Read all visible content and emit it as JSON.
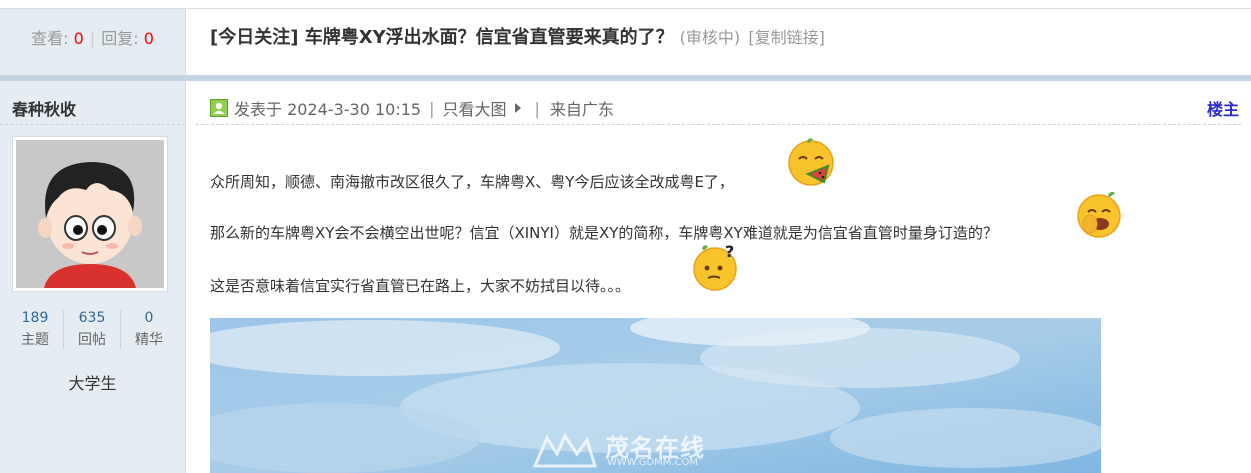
{
  "thread": {
    "views_label": "查看:",
    "views": "0",
    "replies_label": "回复:",
    "replies": "0",
    "title": "[今日关注] 车牌粤XY浮出水面？信宜省直管要来真的了？",
    "status": "(审核中)",
    "copy_link": "[复制链接]"
  },
  "author": {
    "name": "春种秋收",
    "stats": [
      {
        "value": "189",
        "label": "主题"
      },
      {
        "value": "635",
        "label": "回帖"
      },
      {
        "value": "0",
        "label": "精华"
      }
    ],
    "rank": "大学生"
  },
  "post": {
    "posted_at": "发表于 2024-3-30 10:15",
    "only_author": "只看大图",
    "location": "来自广东",
    "floor": "楼主",
    "paragraphs": [
      "众所周知，顺德、南海撤市改区很久了，车牌粤X、粤Y今后应该全改成粤E了，",
      "那么新的车牌粤XY会不会横空出世呢？信宜（XINYI）就是XY的简称，车牌粤XY难道就是为信宜省直管时量身订造的？",
      "这是否意味着信宜实行省直管已在路上，大家不妨拭目以待。。。"
    ],
    "watermark_name": "茂名在线",
    "watermark_url": "WWW.GDMM.COM"
  },
  "colors": {
    "sidebar_bg": "#e5edf2",
    "accent_red": "#ff0000",
    "floor_blue": "#2b2bcc",
    "divider": "#c3d3e2"
  },
  "icons": [
    "online-status-icon",
    "arrow-right-icon",
    "watermelon-emoji-icon",
    "laugh-emoji-icon",
    "question-emoji-icon",
    "site-logo-icon"
  ]
}
